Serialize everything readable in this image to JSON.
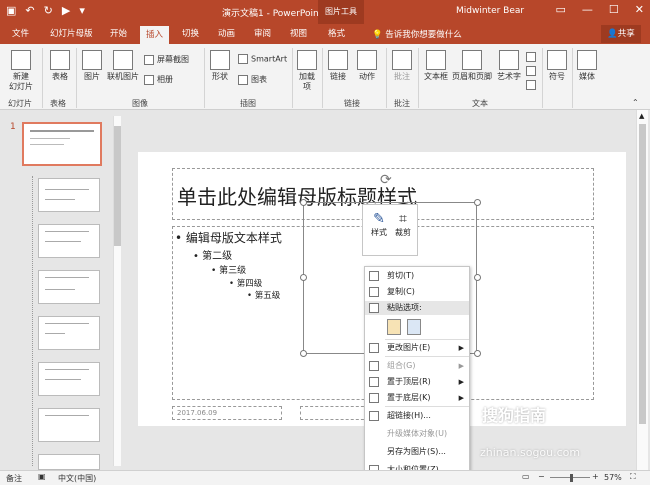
{
  "app": {
    "doc_title": "演示文稿1 - PowerPoint",
    "context_tab": "图片工具",
    "user": "Midwinter Bear"
  },
  "tabs": [
    "文件",
    "幻灯片母版",
    "开始",
    "插入",
    "切换",
    "动画",
    "审阅",
    "视图",
    "格式"
  ],
  "active_tab": "插入",
  "tell_me": "告诉我你想要做什么",
  "share": "共享",
  "ribbon": {
    "new_slide": "新建\n幻灯片",
    "table": "表格",
    "picture": "图片",
    "online_picture": "联机图片",
    "screenshot": "屏幕截图",
    "album": "相册",
    "shapes": "形状",
    "smartart": "SmartArt",
    "chart": "图表",
    "addin": "加载\n项",
    "link": "链接",
    "action": "动作",
    "comment": "批注",
    "textbox": "文本框",
    "header_footer": "页眉和页脚",
    "wordart": "艺术字",
    "symbol": "符号",
    "media": "媒体",
    "groups": [
      "幻灯片",
      "表格",
      "图像",
      "插图",
      "链接",
      "批注",
      "文本"
    ]
  },
  "slide_number": "1",
  "slide": {
    "title": "单击此处编辑母版标题样式",
    "bullets": [
      "编辑母版文本样式",
      "第二级",
      "第三级",
      "第四级",
      "第五级"
    ],
    "date": "2017.06.09"
  },
  "mini_toolbar": {
    "style": "样式",
    "crop": "裁剪"
  },
  "context_menu": {
    "cut": "剪切(T)",
    "copy": "复制(C)",
    "paste_options": "粘贴选项:",
    "change_picture": "更改图片(E)",
    "group": "组合(G)",
    "bring_front": "置于顶层(R)",
    "send_back": "置于底层(K)",
    "hyperlink": "超链接(H)...",
    "upgrade_media": "升级媒体对象(U)",
    "save_as_picture": "另存为图片(S)...",
    "size_position": "大小和位置(Z)..."
  },
  "status": {
    "notes": "备注",
    "language": "中文(中国)",
    "zoom": "57%"
  },
  "watermark": {
    "line1": "搜狗指南",
    "line2": "zhinan.sogou.com"
  },
  "colors": {
    "accent": "#b7472a"
  }
}
